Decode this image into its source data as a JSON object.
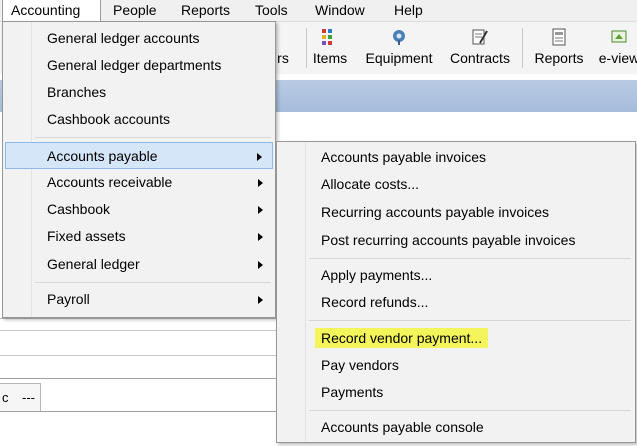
{
  "menubar": {
    "items": [
      "Accounting",
      "People",
      "Reports",
      "Tools",
      "Window",
      "Help"
    ]
  },
  "toolbar": {
    "partial_label": "rs",
    "items": [
      {
        "label": "Items",
        "icon": "items-icon"
      },
      {
        "label": "Equipment",
        "icon": "equipment-icon"
      },
      {
        "label": "Contracts",
        "icon": "contracts-icon"
      },
      {
        "label": "Reports",
        "icon": "reports-icon"
      },
      {
        "label": "e-view",
        "icon": "e-view-icon"
      }
    ]
  },
  "accounting_menu": {
    "items": [
      "General ledger accounts",
      "General ledger departments",
      "Branches",
      "Cashbook accounts",
      "Accounts payable",
      "Accounts receivable",
      "Cashbook",
      "Fixed assets",
      "General ledger",
      "Payroll"
    ]
  },
  "accounts_payable_submenu": {
    "items": [
      "Accounts payable invoices",
      "Allocate costs...",
      "Recurring accounts payable invoices",
      "Post recurring accounts payable invoices",
      "Apply payments...",
      "Record refunds...",
      "Record vendor payment...",
      "Pay vendors",
      "Payments",
      "Accounts payable console"
    ]
  },
  "background": {
    "tab_text_a": "c",
    "tab_text_b": "---"
  },
  "colors": {
    "highlight_yellow": "#f4f55a",
    "hover_blue": "#d5e6f8",
    "band_blue": "#a9bedc"
  }
}
